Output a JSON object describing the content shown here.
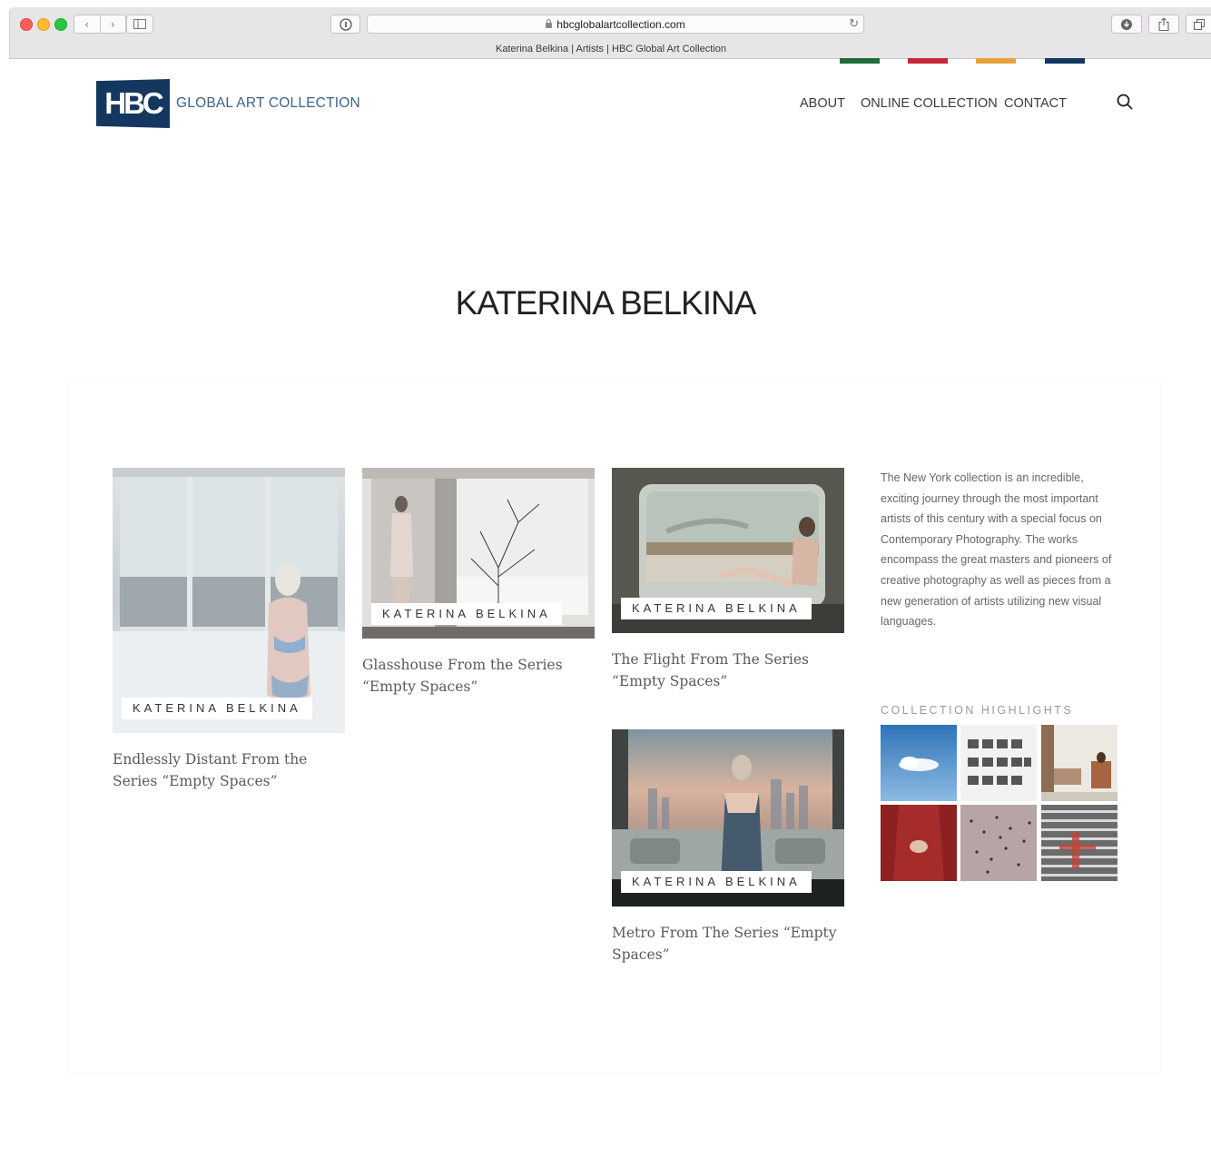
{
  "browser": {
    "url": "hbcglobalartcollection.com",
    "tab_title": "Katerina Belkina | Artists | HBC Global Art Collection"
  },
  "header": {
    "logo_mark": "HBC",
    "logo_text": "GLOBAL ART COLLECTION",
    "nav": [
      "ABOUT",
      "ONLINE COLLECTION",
      "CONTACT"
    ],
    "accent_colors": [
      "#1f6b3a",
      "#c8283a",
      "#e8a23a",
      "#14375f"
    ]
  },
  "page": {
    "title": "KATERINA BELKINA"
  },
  "artworks": [
    {
      "artist_tag": "KATERINA BELKINA",
      "title": "Endlessly Distant From the Series “Empty Spaces”"
    },
    {
      "artist_tag": "KATERINA BELKINA",
      "title": "Glasshouse From the Series “Empty Spaces”"
    },
    {
      "artist_tag": "KATERINA BELKINA",
      "title": "The Flight From The Series “Empty Spaces”"
    },
    {
      "artist_tag": "KATERINA BELKINA",
      "title": "Metro From The Series “Empty Spaces”"
    }
  ],
  "sidebar": {
    "description": "The New York collection is an incredible, exciting journey through the most important artists of this century with a special focus on Contemporary Photography. The works encompass the great masters and pioneers of creative photography as well as pieces from a new generation of artists utilizing new visual languages.",
    "highlights_heading": "COLLECTION HIGHLIGHTS"
  }
}
